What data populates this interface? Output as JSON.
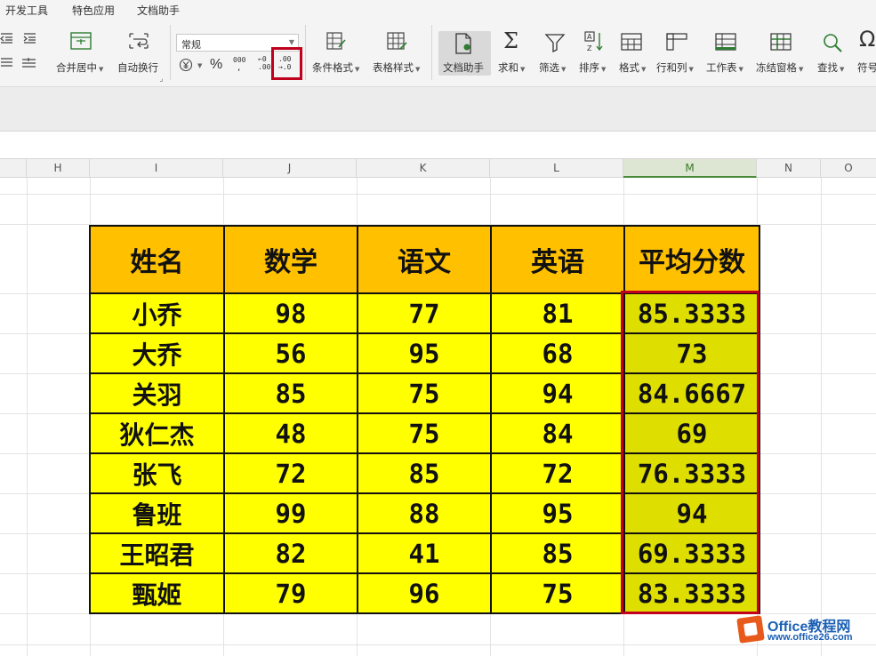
{
  "menu": {
    "tabs": [
      "开发工具",
      "特色应用",
      "文档助手"
    ]
  },
  "ribbon": {
    "merge_label": "合并居中",
    "wrap_label": "自动换行",
    "number_format": "常规",
    "percent_symbol": "%",
    "thousands_symbol": "000",
    "increase_decimal_top": "←0",
    "increase_decimal_bottom": ".00",
    "decrease_decimal_top": ".00",
    "decrease_decimal_bottom": "→.0",
    "conditional_format_label": "条件格式",
    "table_style_label": "表格样式",
    "doc_assistant_label": "文档助手",
    "sum_label": "求和",
    "filter_label": "筛选",
    "sort_label": "排序",
    "format_label": "格式",
    "row_col_label": "行和列",
    "worksheet_label": "工作表",
    "freeze_label": "冻结窗格",
    "find_label": "查找",
    "symbol_label": "符号"
  },
  "columns": [
    "H",
    "I",
    "J",
    "K",
    "L",
    "M",
    "N",
    "O"
  ],
  "active_column": "M",
  "table": {
    "headers": [
      "姓名",
      "数学",
      "语文",
      "英语",
      "平均分数"
    ],
    "rows": [
      {
        "name": "小乔",
        "math": "98",
        "chinese": "77",
        "english": "81",
        "avg": "85.3333"
      },
      {
        "name": "大乔",
        "math": "56",
        "chinese": "95",
        "english": "68",
        "avg": "73"
      },
      {
        "name": "关羽",
        "math": "85",
        "chinese": "75",
        "english": "94",
        "avg": "84.6667"
      },
      {
        "name": "狄仁杰",
        "math": "48",
        "chinese": "75",
        "english": "84",
        "avg": "69"
      },
      {
        "name": "张飞",
        "math": "72",
        "chinese": "85",
        "english": "72",
        "avg": "76.3333"
      },
      {
        "name": "鲁班",
        "math": "99",
        "chinese": "88",
        "english": "95",
        "avg": "94"
      },
      {
        "name": "王昭君",
        "math": "82",
        "chinese": "41",
        "english": "85",
        "avg": "69.3333"
      },
      {
        "name": "甄姬",
        "math": "79",
        "chinese": "96",
        "english": "75",
        "avg": "83.3333"
      }
    ]
  },
  "watermark": {
    "brand": "Office教程网",
    "url": "www.office26.com"
  },
  "colors": {
    "header_fill": "#ffc000",
    "cell_fill": "#ffff00",
    "avg_fill": "#dede00",
    "highlight_border": "#c0001d"
  }
}
